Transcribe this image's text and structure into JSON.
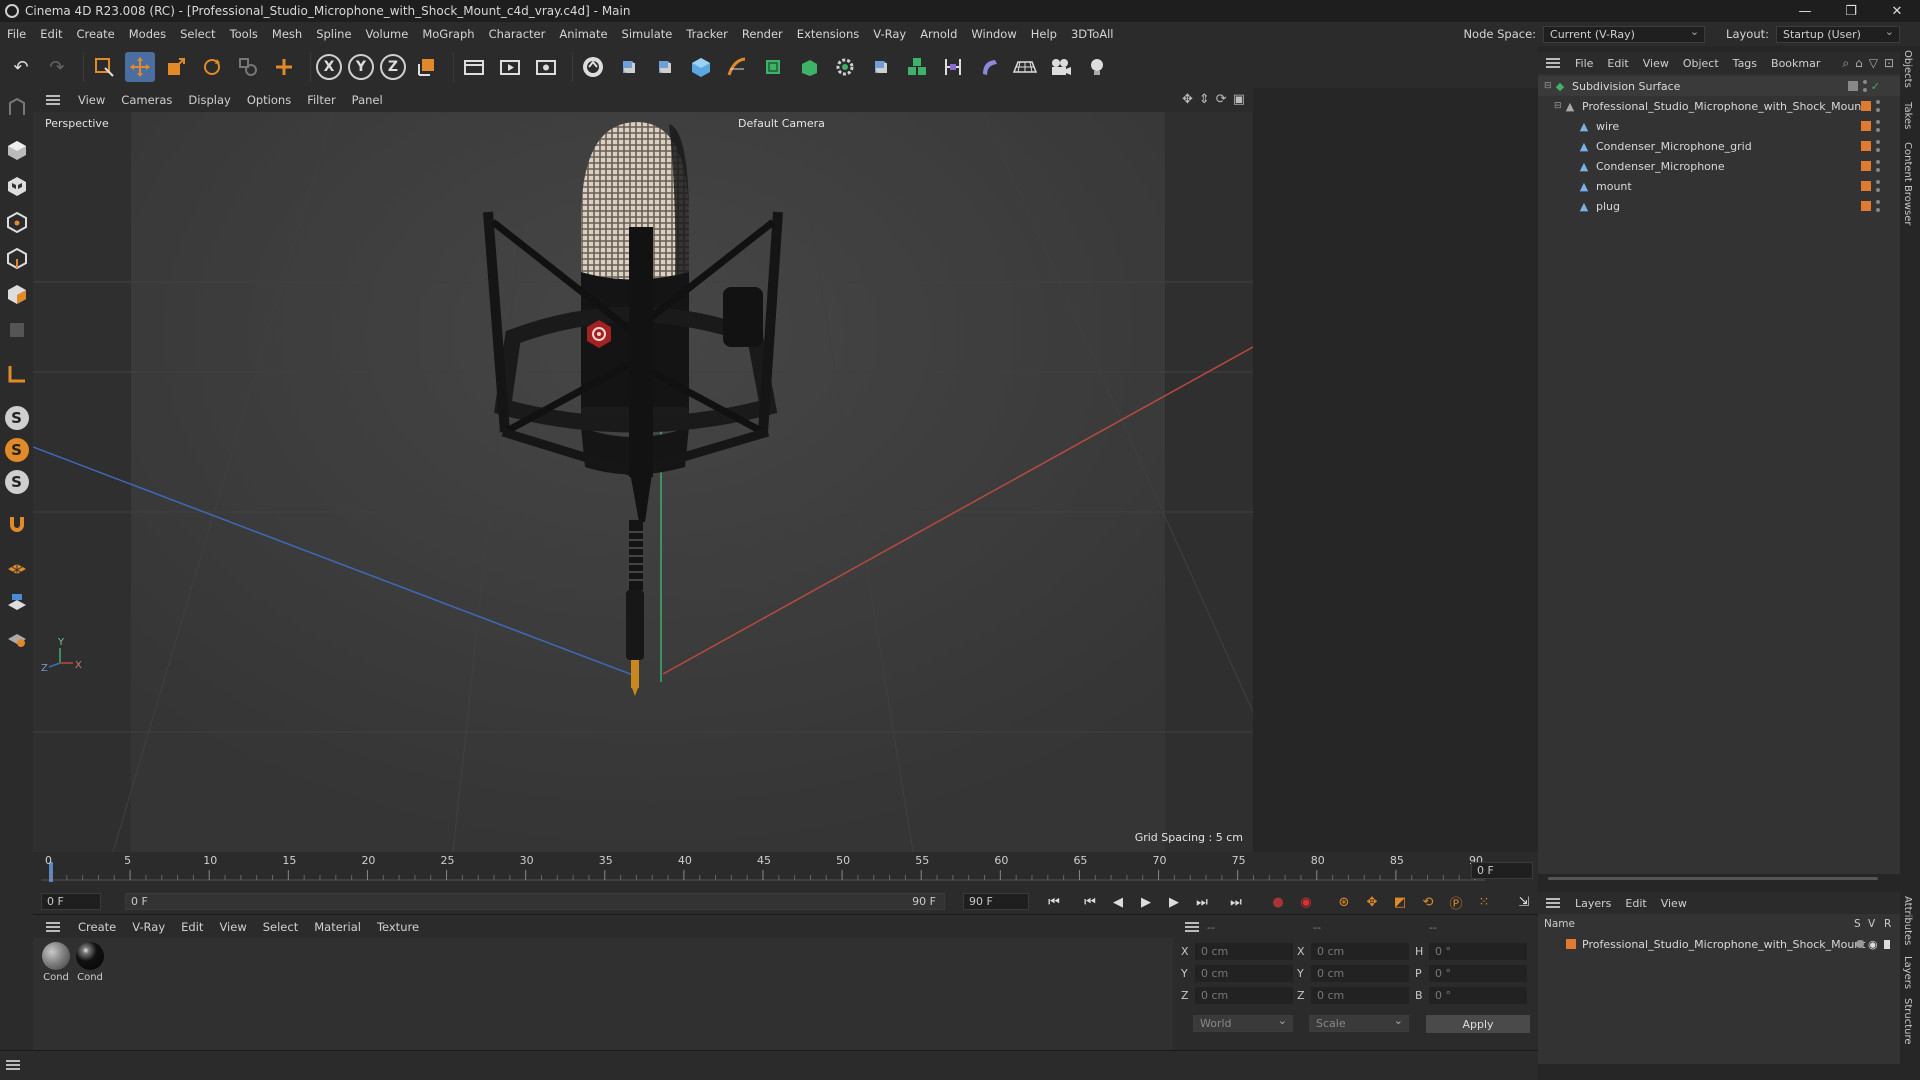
{
  "app_title": "Cinema 4D R23.008 (RC) - [Professional_Studio_Microphone_with_Shock_Mount_c4d_vray.c4d] - Main",
  "window_controls": {
    "minimize": "—",
    "maximize": "❐",
    "close": "✕"
  },
  "menu": [
    "File",
    "Edit",
    "Create",
    "Modes",
    "Select",
    "Tools",
    "Mesh",
    "Spline",
    "Volume",
    "MoGraph",
    "Character",
    "Animate",
    "Simulate",
    "Tracker",
    "Render",
    "Extensions",
    "V-Ray",
    "Arnold",
    "Window",
    "Help",
    "3DToAll"
  ],
  "node_space": {
    "label": "Node Space:",
    "value": "Current (V-Ray)"
  },
  "layout": {
    "label": "Layout:",
    "value": "Startup (User)"
  },
  "toolbar": {
    "undo": "↶",
    "redo": "↷",
    "axis_x": "X",
    "axis_y": "Y",
    "axis_z": "Z"
  },
  "viewport_menu": [
    "View",
    "Cameras",
    "Display",
    "Options",
    "Filter",
    "Panel"
  ],
  "viewport": {
    "label": "Perspective",
    "camera": "Default Camera",
    "grid_spacing": "Grid Spacing : 5 cm",
    "axis_y": "Y",
    "axis_x": "X",
    "axis_z": "Z"
  },
  "timeline": {
    "ticks": [
      "0",
      "5",
      "10",
      "15",
      "20",
      "25",
      "30",
      "35",
      "40",
      "45",
      "50",
      "55",
      "60",
      "65",
      "70",
      "75",
      "80",
      "85",
      "90"
    ],
    "current_frame": "0 F",
    "start_field": "0 F",
    "range_start": "0 F",
    "range_end": "90 F",
    "end_field": "90 F"
  },
  "material_menu": [
    "Create",
    "V-Ray",
    "Edit",
    "View",
    "Select",
    "Material",
    "Texture"
  ],
  "materials": [
    {
      "label": "Cond",
      "color": "#7a7a7a"
    },
    {
      "label": "Cond",
      "color": "#111111"
    }
  ],
  "coords": {
    "header1": "--",
    "header2": "--",
    "header3": "--",
    "x_label": "X",
    "y_label": "Y",
    "z_label": "Z",
    "x_pos": "0 cm",
    "y_pos": "0 cm",
    "z_pos": "0 cm",
    "x2_label": "X",
    "y2_label": "Y",
    "z2_label": "Z",
    "x_size": "0 cm",
    "y_size": "0 cm",
    "z_size": "0 cm",
    "h_label": "H",
    "p_label": "P",
    "b_label": "B",
    "h_rot": "0 °",
    "p_rot": "0 °",
    "b_rot": "0 °",
    "coord_system": "World",
    "mode": "Scale",
    "apply": "Apply"
  },
  "object_menu": [
    "File",
    "Edit",
    "View",
    "Object",
    "Tags",
    "Bookmar"
  ],
  "objects": [
    {
      "name": "Subdivision Surface",
      "indent": 0
    },
    {
      "name": "Professional_Studio_Microphone_with_Shock_Mount",
      "indent": 1
    },
    {
      "name": "wire",
      "indent": 2
    },
    {
      "name": "Condenser_Microphone_grid",
      "indent": 2
    },
    {
      "name": "Condenser_Microphone",
      "indent": 2
    },
    {
      "name": "mount",
      "indent": 2
    },
    {
      "name": "plug",
      "indent": 2
    }
  ],
  "layers_menu": [
    "Layers",
    "Edit",
    "View"
  ],
  "layers": {
    "col_name": "Name",
    "col_s": "S",
    "col_v": "V",
    "col_r": "R",
    "row": "Professional_Studio_Microphone_with_Shock_Mount"
  },
  "side_tabs": [
    "Objects",
    "Takes",
    "Content Browser",
    "Attributes",
    "Layers",
    "Structure"
  ],
  "colors": {
    "accent": "#e07a30",
    "selection": "#4a6ea0"
  }
}
